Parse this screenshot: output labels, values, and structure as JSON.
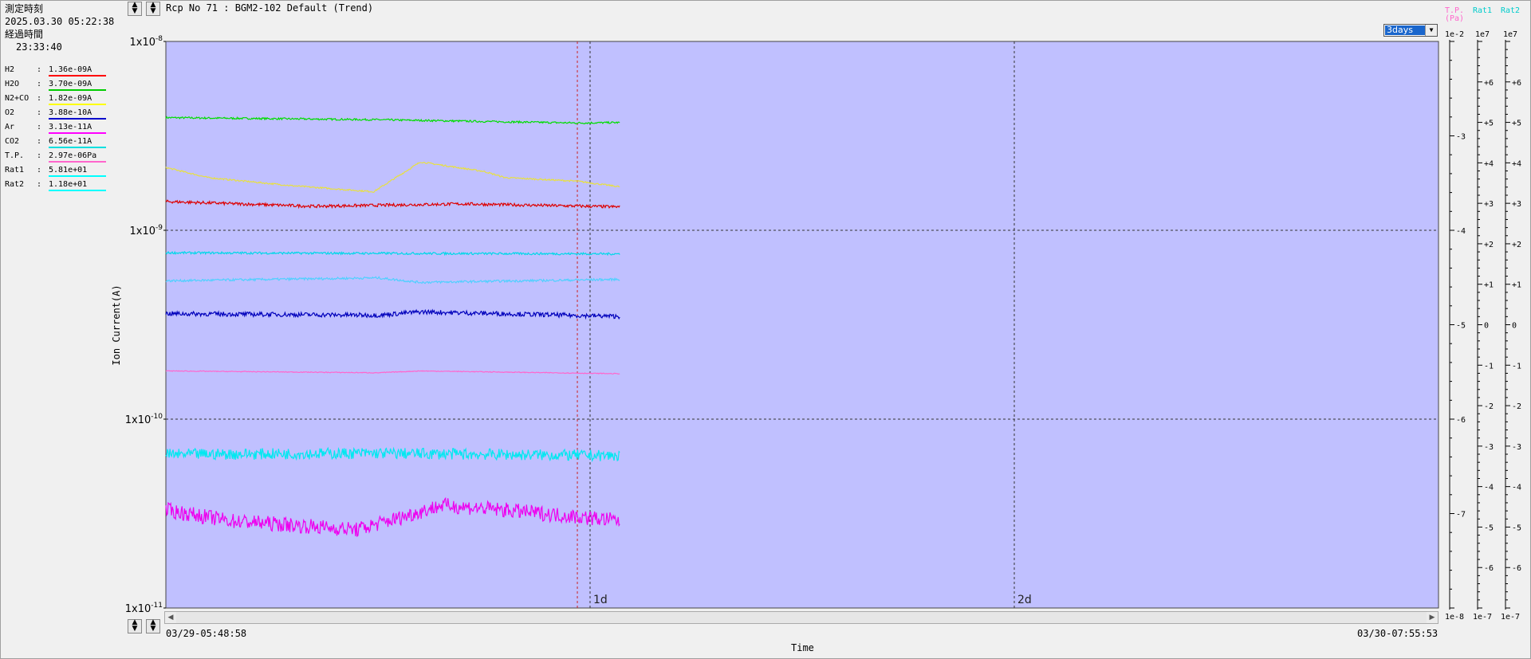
{
  "header": {
    "measure_label": "測定時刻",
    "measure_time": "2025.03.30 05:22:38",
    "elapsed_label": "経過時間",
    "elapsed_time": "23:33:40",
    "title": "Rcp No 71 : BGM2-102 Default (Trend)",
    "range_select": "3days"
  },
  "legend": [
    {
      "name": "H2",
      "value": "1.36e-09A",
      "color": "#ff0000"
    },
    {
      "name": "H2O",
      "value": "3.70e-09A",
      "color": "#00cc00"
    },
    {
      "name": "N2+CO",
      "value": "1.82e-09A",
      "color": "#ffff00"
    },
    {
      "name": "O2",
      "value": "3.88e-10A",
      "color": "#0000cc"
    },
    {
      "name": "Ar",
      "value": "3.13e-11A",
      "color": "#ff00ff"
    },
    {
      "name": "CO2",
      "value": "6.56e-11A",
      "color": "#00e0e0"
    },
    {
      "name": "T.P.",
      "value": "2.97e-06Pa",
      "color": "#ff66cc"
    },
    {
      "name": "Rat1",
      "value": "5.81e+01",
      "color": "#00ffff"
    },
    {
      "name": "Rat2",
      "value": "1.18e+01",
      "color": "#00ffff"
    }
  ],
  "chart_data": {
    "type": "line",
    "ylabel": "Ion Current(A)",
    "xlabel": "Time",
    "y_scale": "log",
    "ylim": [
      1e-11,
      1e-08
    ],
    "y_ticks": [
      {
        "base": "1x10",
        "exp": "-8"
      },
      {
        "base": "1x10",
        "exp": "-9"
      },
      {
        "base": "1x10",
        "exp": "-10"
      },
      {
        "base": "1x10",
        "exp": "-11"
      }
    ],
    "x_days": [
      0,
      3
    ],
    "x_ticks": [
      {
        "day": 1,
        "label": "1d"
      },
      {
        "day": 2,
        "label": "2d"
      }
    ],
    "x_start_label": "03/29-05:48:58",
    "x_end_label": "03/30-07:55:53",
    "cursor_day": 0.97,
    "plot_bg": "#c0c0ff",
    "series": [
      {
        "color": "#00dd00",
        "points": [
          [
            0,
            3.95e-09
          ],
          [
            0.5,
            3.85e-09
          ],
          [
            0.97,
            3.7e-09
          ],
          [
            1.07,
            3.72e-09
          ]
        ],
        "noise": 0.005
      },
      {
        "color": "#e8e040",
        "points": [
          [
            0,
            2.15e-09
          ],
          [
            0.1,
            1.9e-09
          ],
          [
            0.3,
            1.72e-09
          ],
          [
            0.49,
            1.6e-09
          ],
          [
            0.6,
            2.3e-09
          ],
          [
            0.75,
            2.05e-09
          ],
          [
            0.8,
            1.9e-09
          ],
          [
            0.97,
            1.82e-09
          ],
          [
            1.07,
            1.7e-09
          ]
        ],
        "noise": 0.004
      },
      {
        "color": "#dd0000",
        "points": [
          [
            0,
            1.42e-09
          ],
          [
            0.35,
            1.34e-09
          ],
          [
            0.7,
            1.38e-09
          ],
          [
            1.07,
            1.33e-09
          ]
        ],
        "noise": 0.008
      },
      {
        "color": "#00d8e8",
        "points": [
          [
            0,
            7.6e-10
          ],
          [
            0.5,
            7.55e-10
          ],
          [
            1.07,
            7.5e-10
          ]
        ],
        "noise": 0.006
      },
      {
        "color": "#50d0ff",
        "points": [
          [
            0,
            5.4e-10
          ],
          [
            0.5,
            5.6e-10
          ],
          [
            0.6,
            5.3e-10
          ],
          [
            1.07,
            5.5e-10
          ]
        ],
        "noise": 0.006
      },
      {
        "color": "#0000bb",
        "points": [
          [
            0,
            3.62e-10
          ],
          [
            0.5,
            3.55e-10
          ],
          [
            0.6,
            3.7e-10
          ],
          [
            1.07,
            3.5e-10
          ]
        ],
        "noise": 0.012
      },
      {
        "color": "#ff66cc",
        "points": [
          [
            0,
            1.8e-10
          ],
          [
            0.5,
            1.76e-10
          ],
          [
            0.6,
            1.8e-10
          ],
          [
            1.07,
            1.74e-10
          ]
        ],
        "noise": 0.002
      },
      {
        "color": "#00e8f0",
        "points": [
          [
            0,
            6.5e-11
          ],
          [
            0.5,
            6.6e-11
          ],
          [
            1.07,
            6.4e-11
          ]
        ],
        "noise": 0.03
      },
      {
        "color": "#ee00ee",
        "points": [
          [
            0,
            3.3e-11
          ],
          [
            0.15,
            2.9e-11
          ],
          [
            0.45,
            2.6e-11
          ],
          [
            0.55,
            3e-11
          ],
          [
            0.65,
            3.5e-11
          ],
          [
            0.8,
            3.3e-11
          ],
          [
            1.07,
            2.9e-11
          ]
        ],
        "noise": 0.04
      }
    ],
    "right_axes": [
      {
        "header": "T.P.\n(Pa)",
        "header_color": "#ff66cc",
        "top": "1e-2",
        "bottom": "1e-8",
        "ticks": [
          {
            "label": "-3",
            "v": 1
          },
          {
            "label": "-4",
            "v": 2
          },
          {
            "label": "-5",
            "v": 3
          },
          {
            "label": "-6",
            "v": 4
          },
          {
            "label": "-7",
            "v": 5
          }
        ],
        "divisions": 6
      },
      {
        "header": "Rat1",
        "header_color": "#00cccc",
        "top": "1e7",
        "bottom": "1e-7",
        "ticks": [
          {
            "label": "+6",
            "v": 1
          },
          {
            "label": "+5",
            "v": 2
          },
          {
            "label": "+4",
            "v": 3
          },
          {
            "label": "+3",
            "v": 4
          },
          {
            "label": "+2",
            "v": 5
          },
          {
            "label": "+1",
            "v": 6
          },
          {
            "label": "0",
            "v": 7
          },
          {
            "label": "-1",
            "v": 8
          },
          {
            "label": "-2",
            "v": 9
          },
          {
            "label": "-3",
            "v": 10
          },
          {
            "label": "-4",
            "v": 11
          },
          {
            "label": "-5",
            "v": 12
          },
          {
            "label": "-6",
            "v": 13
          }
        ],
        "divisions": 14
      },
      {
        "header": "Rat2",
        "header_color": "#00cccc",
        "top": "1e7",
        "bottom": "1e-7",
        "ticks": [
          {
            "label": "+6",
            "v": 1
          },
          {
            "label": "+5",
            "v": 2
          },
          {
            "label": "+4",
            "v": 3
          },
          {
            "label": "+3",
            "v": 4
          },
          {
            "label": "+2",
            "v": 5
          },
          {
            "label": "+1",
            "v": 6
          },
          {
            "label": "0",
            "v": 7
          },
          {
            "label": "-1",
            "v": 8
          },
          {
            "label": "-2",
            "v": 9
          },
          {
            "label": "-3",
            "v": 10
          },
          {
            "label": "-4",
            "v": 11
          },
          {
            "label": "-5",
            "v": 12
          },
          {
            "label": "-6",
            "v": 13
          }
        ],
        "divisions": 14
      }
    ]
  }
}
